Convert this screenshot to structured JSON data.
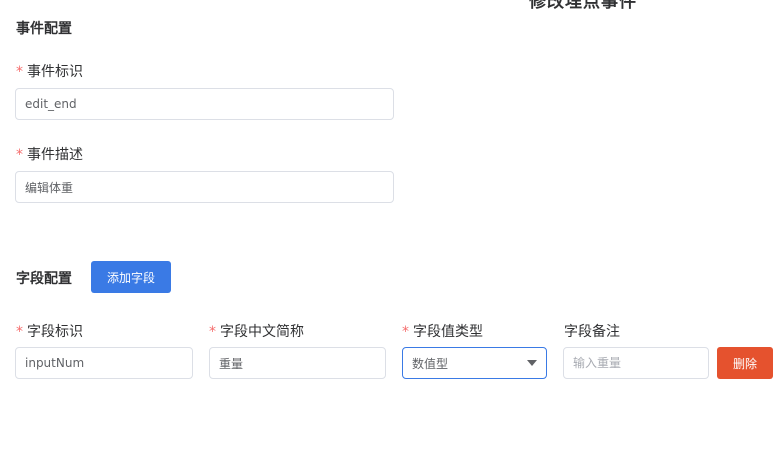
{
  "dialog": {
    "title": "修改埋点事件"
  },
  "event_config": {
    "section_title": "事件配置",
    "event_id": {
      "label": "事件标识",
      "value": "edit_end"
    },
    "event_desc": {
      "label": "事件描述",
      "value": "编辑体重"
    }
  },
  "field_config": {
    "section_title": "字段配置",
    "add_button": "添加字段",
    "columns": {
      "field_id": "字段标识",
      "field_cn_name": "字段中文简称",
      "field_value_type": "字段值类型",
      "field_note": "字段备注"
    },
    "rows": [
      {
        "field_id": "inputNum",
        "field_cn_name": "重量",
        "field_value_type": "数值型",
        "field_note_placeholder": "输入重量",
        "delete_button": "删除"
      }
    ]
  },
  "colors": {
    "primary": "#3a7ae5",
    "danger": "#e5522e",
    "required": "#f56c6c"
  }
}
